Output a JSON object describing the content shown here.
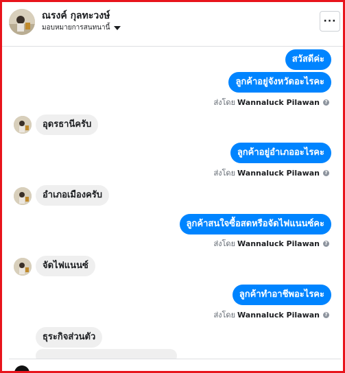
{
  "header": {
    "name": "ณรงค์ กุลทะวงษ์",
    "status": "มอบหมายการสนทนานี้"
  },
  "sent_by_prefix": "ส่งโดย",
  "sent_by_name": "Wannaluck Pilawan",
  "messages": {
    "m1": "สวัสดีค่ะ",
    "m2": "ลูกค้าอยู่จังหวัดอะไรคะ",
    "m3": "อุดรธานีครับ",
    "m4": "ลูกค้าอยู่อำเภออะไรคะ",
    "m5": "อำเภอเมืองครับ",
    "m6": "ลูกค้าสนใจซื้อสดหรือจัดไฟแนนซ์คะ",
    "m7": "จัดไฟแนนซ์",
    "m8": "ลูกค้าทำอาชีพอะไรคะ",
    "m9": "ธุระกิจส่วนตัว"
  },
  "colors": {
    "outgoing": "#0084ff",
    "incoming": "#efefef",
    "frame": "#e8141c"
  },
  "icons": {
    "more": "ellipsis-icon",
    "caret": "caret-down-icon",
    "help": "question-circle-icon"
  },
  "more_label": "···",
  "help_glyph": "?"
}
